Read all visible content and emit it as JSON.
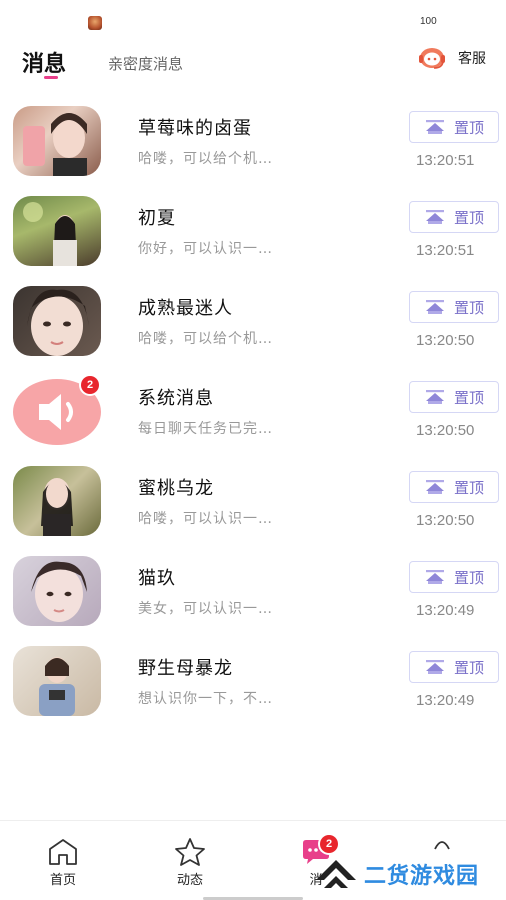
{
  "status_bar": {
    "battery": "100"
  },
  "header": {
    "tab_main": "消息",
    "tab_secondary": "亲密度消息",
    "service_label": "客服"
  },
  "conversations": [
    {
      "name": "草莓味的卤蛋",
      "preview": "哈喽，可以给个机…",
      "pin_label": "置顶",
      "time": "13:20:51",
      "avatar": "photo"
    },
    {
      "name": "初夏",
      "preview": "你好，可以认识一…",
      "pin_label": "置顶",
      "time": "13:20:51",
      "avatar": "photo"
    },
    {
      "name": "成熟最迷人",
      "preview": "哈喽，可以给个机…",
      "pin_label": "置顶",
      "time": "13:20:50",
      "avatar": "photo"
    },
    {
      "name": "系统消息",
      "preview": "每日聊天任务已完…",
      "pin_label": "置顶",
      "time": "13:20:50",
      "avatar": "speaker-icon",
      "badge": "2"
    },
    {
      "name": "蜜桃乌龙",
      "preview": "哈喽，可以认识一…",
      "pin_label": "置顶",
      "time": "13:20:50",
      "avatar": "photo"
    },
    {
      "name": "猫玖",
      "preview": "美女，可以认识一…",
      "pin_label": "置顶",
      "time": "13:20:49",
      "avatar": "photo"
    },
    {
      "name": "野生母暴龙",
      "preview": "想认识你一下，不…",
      "pin_label": "置顶",
      "time": "13:20:49",
      "avatar": "photo"
    }
  ],
  "bottom_nav": {
    "home_label": "首页",
    "moments_label": "动态",
    "messages_label": "消",
    "messages_badge": "2"
  },
  "watermark": {
    "text": "二货游戏园"
  },
  "colors": {
    "accent_pink": "#e83f8a",
    "pin_purple": "#7a70c9",
    "badge_red": "#e8262d",
    "watermark_blue": "#2f8be0"
  }
}
